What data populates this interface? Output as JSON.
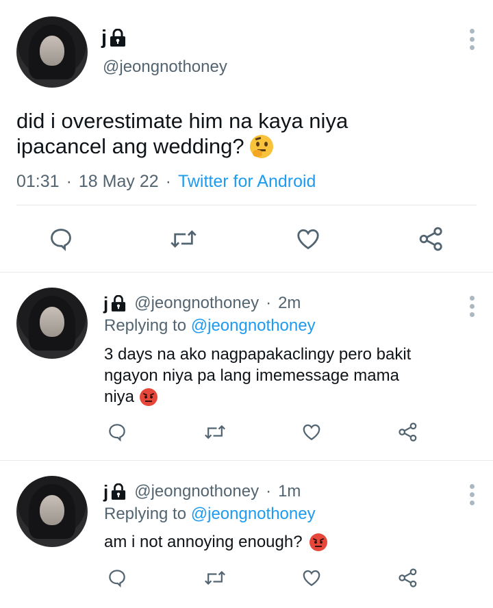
{
  "main_tweet": {
    "display_name": "j",
    "handle": "@jeongnothoney",
    "text": "did i overestimate him na kaya niya ipacancel ang wedding?",
    "text_line1": "did i overestimate him na kaya niya",
    "text_line2": "ipacancel ang wedding?",
    "emoji": "thinking-face",
    "time": "01:31",
    "date": "18 May 22",
    "source": "Twitter for Android",
    "separator": "·"
  },
  "replies": [
    {
      "display_name": "j",
      "handle": "@jeongnothoney",
      "time_ago": "2m",
      "replying_prefix": "Replying to",
      "replying_to": "@jeongnothoney",
      "text_line1": "3 days na ako nagpapakaclingy pero bakit",
      "text_line2": "ngayon niya pa lang imemessage mama",
      "text_line3": "niya",
      "emoji": "pouting-face"
    },
    {
      "display_name": "j",
      "handle": "@jeongnothoney",
      "time_ago": "1m",
      "replying_prefix": "Replying to",
      "replying_to": "@jeongnothoney",
      "text_line1": "am i not annoying enough?",
      "emoji": "pouting-face"
    }
  ],
  "icons": {
    "lock": "lock-icon",
    "reply": "reply-icon",
    "retweet": "retweet-icon",
    "like": "heart-icon",
    "share": "share-icon",
    "more": "more-vertical-icon"
  },
  "colors": {
    "text": "#0f1419",
    "secondary": "#536471",
    "link": "#1d9bf0",
    "divider": "#e7e9ea",
    "action_icon": "#536471"
  }
}
